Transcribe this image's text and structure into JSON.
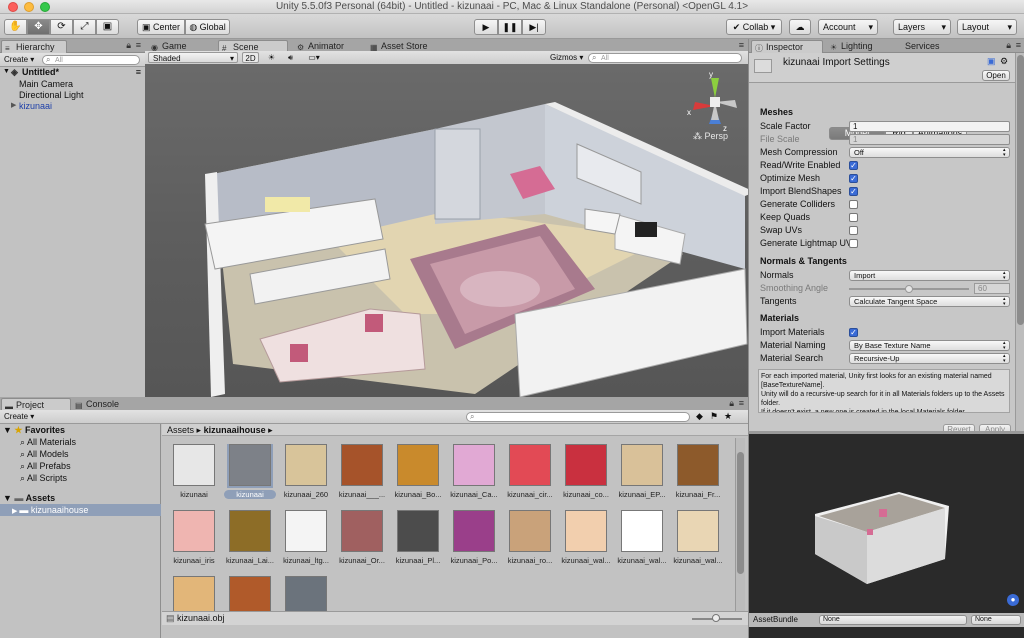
{
  "window": {
    "title": "Unity 5.5.0f3 Personal (64bit) - Untitled - kizunaai - PC, Mac & Linux Standalone (Personal) <OpenGL 4.1>"
  },
  "toolbar": {
    "tools": [
      "hand-tool",
      "move-tool",
      "rotate-tool",
      "scale-tool",
      "rect-tool"
    ],
    "center_label": "Center",
    "global_label": "Global",
    "collab_label": "Collab ▾",
    "account_label": "Account",
    "layers_label": "Layers",
    "layout_label": "Layout"
  },
  "hierarchy": {
    "tab_label": "Hierarchy",
    "create_label": "Create",
    "search_placeholder": "All",
    "scene_name": "Untitled*",
    "items": [
      "Main Camera",
      "Directional Light",
      "kizunaai"
    ]
  },
  "scene_view": {
    "tabs": [
      "Game",
      "Scene",
      "Animator",
      "Asset Store"
    ],
    "shading_mode": "Shaded",
    "mode_2d": "2D",
    "gizmos_label": "Gizmos",
    "search_placeholder": "All",
    "persp_label": "Persp",
    "axis_labels": {
      "x": "x",
      "y": "y",
      "z": "z"
    }
  },
  "project": {
    "tabs": [
      "Project",
      "Console"
    ],
    "create_label": "Create",
    "favorites_label": "Favorites",
    "favorites": [
      "All Materials",
      "All Models",
      "All Prefabs",
      "All Scripts"
    ],
    "assets_label": "Assets",
    "assets_children": [
      "kizunaaihouse"
    ],
    "breadcrumb": [
      "Assets",
      "kizunaaihouse"
    ],
    "footer_path": "kizunaai.obj",
    "assets": [
      {
        "label": "kizunaai",
        "color": "#e7e7e7"
      },
      {
        "label": "kizunaai",
        "color": "#7d8188"
      },
      {
        "label": "kizunaai_260",
        "color": "#d8c49a"
      },
      {
        "label": "kizunaai___...",
        "color": "#a6532a"
      },
      {
        "label": "kizunaai_Bo...",
        "color": "#c98a2c"
      },
      {
        "label": "kizunaai_Ca...",
        "color": "#e1a9d4"
      },
      {
        "label": "kizunaai_cir...",
        "color": "#e24a55"
      },
      {
        "label": "kizunaai_co...",
        "color": "#c9303f"
      },
      {
        "label": "kizunaai_EP...",
        "color": "#d9c199"
      },
      {
        "label": "kizunaai_Fr...",
        "color": "#8d5a2b"
      },
      {
        "label": "kizunaai_iris",
        "color": "#efb5b1"
      },
      {
        "label": "kizunaai_Lai...",
        "color": "#8d6d27"
      },
      {
        "label": "kizunaai_ltg...",
        "color": "#f4f4f4"
      },
      {
        "label": "kizunaai_Or...",
        "color": "#a06060"
      },
      {
        "label": "kizunaai_Pl...",
        "color": "#4c4c4c"
      },
      {
        "label": "kizunaai_Po...",
        "color": "#9a3f8a"
      },
      {
        "label": "kizunaai_ro...",
        "color": "#c9a27a"
      },
      {
        "label": "kizunaai_wal...",
        "color": "#f2cfae"
      },
      {
        "label": "kizunaai_wal...",
        "color": "#ffffff"
      },
      {
        "label": "kizunaai_wal...",
        "color": "#e9d6b4"
      },
      {
        "label": "",
        "color": "#e2b679"
      },
      {
        "label": "",
        "color": "#b05a2a"
      },
      {
        "label": "",
        "color": "#6b737c"
      }
    ]
  },
  "inspector": {
    "tabs": [
      "Inspector",
      "Lighting",
      "Services"
    ],
    "header_title": "kizunaai Import Settings",
    "open_label": "Open",
    "segments": [
      "Model",
      "Rig",
      "Animations"
    ],
    "meshes_label": "Meshes",
    "rows": [
      {
        "label": "Scale Factor",
        "type": "field",
        "value": "1"
      },
      {
        "label": "File Scale",
        "type": "field",
        "value": "1",
        "dim": true
      },
      {
        "label": "Mesh Compression",
        "type": "drop",
        "value": "Off"
      },
      {
        "label": "Read/Write Enabled",
        "type": "check",
        "checked": true
      },
      {
        "label": "Optimize Mesh",
        "type": "check",
        "checked": true
      },
      {
        "label": "Import BlendShapes",
        "type": "check",
        "checked": true
      },
      {
        "label": "Generate Colliders",
        "type": "check",
        "checked": false
      },
      {
        "label": "Keep Quads",
        "type": "check",
        "checked": false
      },
      {
        "label": "Swap UVs",
        "type": "check",
        "checked": false
      },
      {
        "label": "Generate Lightmap UV",
        "type": "check",
        "checked": false
      }
    ],
    "normals_section": "Normals & Tangents",
    "normals_rows": [
      {
        "label": "Normals",
        "type": "drop",
        "value": "Import"
      },
      {
        "label": "Smoothing Angle",
        "type": "slider",
        "value": "60",
        "dim": true,
        "fraction": 0.5
      },
      {
        "label": "Tangents",
        "type": "drop",
        "value": "Calculate Tangent Space"
      }
    ],
    "materials_section": "Materials",
    "materials_rows": [
      {
        "label": "Import Materials",
        "type": "check",
        "checked": true
      },
      {
        "label": "Material Naming",
        "type": "drop",
        "value": "By Base Texture Name"
      },
      {
        "label": "Material Search",
        "type": "drop",
        "value": "Recursive-Up"
      }
    ],
    "help_text": "For each imported material, Unity first looks for an existing material named [BaseTextureName].\nUnity will do a recursive-up search for it in all Materials folders up to the Assets folder.\nIf it doesn't exist, a new one is created in the local Materials folder.",
    "revert_label": "Revert",
    "apply_label": "Apply",
    "assetbundle_label": "AssetBundle",
    "assetbundle_value": "None",
    "assetbundle_variant": "None"
  },
  "colors": {
    "accent_blue": "#3a6bd6",
    "selection": "#8f9fb8",
    "preview_bg": "#2a2a2a"
  }
}
